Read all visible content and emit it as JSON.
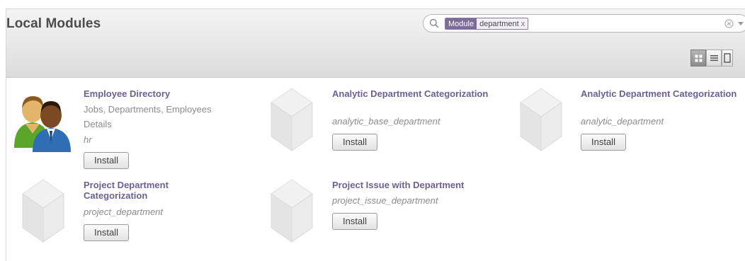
{
  "header": {
    "title": "Local Modules"
  },
  "search": {
    "facet_category": "Module",
    "facet_value": "department",
    "facet_remove": "x"
  },
  "view_switch": [
    {
      "name": "kanban",
      "active": true
    },
    {
      "name": "list",
      "active": false
    },
    {
      "name": "form",
      "active": false
    }
  ],
  "modules": [
    {
      "name": "Employee Directory",
      "summary": "Jobs, Departments, Employees Details",
      "technical": "hr",
      "button": "Install",
      "icon": "employees-icon"
    },
    {
      "name": "Analytic Department Categorization",
      "summary": "",
      "technical": "analytic_base_department",
      "button": "Install",
      "icon": "module-cube-icon"
    },
    {
      "name": "Analytic Department Categorization",
      "summary": "",
      "technical": "analytic_department",
      "button": "Install",
      "icon": "module-cube-icon"
    },
    {
      "name": "Project Department Categorization",
      "summary": "",
      "technical": "project_department",
      "button": "Install",
      "icon": "module-cube-icon"
    },
    {
      "name": "Project Issue with Department",
      "summary": "",
      "technical": "project_issue_department",
      "button": "Install",
      "icon": "module-cube-icon"
    }
  ],
  "colors": {
    "accent": "#7c6c97",
    "module_name": "#6e5f94",
    "muted_text": "#8c8c8c"
  }
}
